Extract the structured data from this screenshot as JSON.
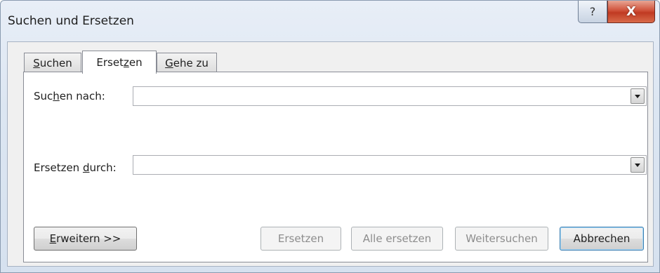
{
  "window": {
    "title": "Suchen und Ersetzen",
    "help_glyph": "?",
    "close_glyph": "X"
  },
  "tabs": [
    {
      "pre": "",
      "accel": "S",
      "post": "uchen"
    },
    {
      "pre": "Erset",
      "accel": "z",
      "post": "en"
    },
    {
      "pre": "",
      "accel": "G",
      "post": "ehe zu"
    }
  ],
  "active_tab": "Ersetzen",
  "search": {
    "label_pre": "Suc",
    "label_accel": "h",
    "label_post": "en nach:",
    "value": ""
  },
  "replace": {
    "label_pre": "Ersetzen ",
    "label_accel": "d",
    "label_post": "urch:",
    "value": ""
  },
  "buttons": {
    "expand_accel": "E",
    "expand_post": "rweitern >>",
    "replace": "Ersetzen",
    "replace_all": "Alle ersetzen",
    "find_next": "Weitersuchen",
    "cancel": "Abbrechen"
  }
}
